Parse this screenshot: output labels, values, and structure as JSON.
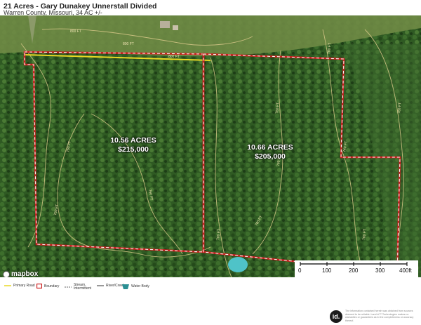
{
  "header": {
    "title": "21 Acres - Gary Dunakey Unnerstall Divided",
    "subtitle": "Warren County, Missouri, 34 AC +/-"
  },
  "map": {
    "parcels": [
      {
        "acres": "10.56 ACRES",
        "price": "$215,000"
      },
      {
        "acres": "10.66 ACRES",
        "price": "$205,000"
      }
    ],
    "contour_labels": [
      "800 FT",
      "800 FT",
      "800 FT",
      "760 FT",
      "760 FT",
      "760 FT",
      "760 FT",
      "760 FT",
      "760 FT",
      "760 FT",
      "760 FT",
      "740 FT",
      "760 FT",
      "760 FT"
    ],
    "attribution": "mapbox",
    "scale_ticks": [
      "0",
      "100",
      "200",
      "300",
      "400ft"
    ],
    "colors": {
      "boundary": "#cc1f1f",
      "boundary_dash": "#ffffff",
      "primary_road": "#e8d824",
      "contour": "#d9c98a",
      "water": "#4fc3c8"
    }
  },
  "legend": {
    "items": [
      {
        "label": "Primary Road"
      },
      {
        "label": "Boundary"
      },
      {
        "label": "Stream, Intermittent"
      },
      {
        "label": "River/Creek"
      },
      {
        "label": "Water Body"
      }
    ]
  },
  "footer": {
    "logo": "id.",
    "disclaimer": "The information contained herein was obtained from sources deemed to be reliable. Land id™ Technologies makes no warranties or guarantees as to the completeness or accuracy thereof."
  }
}
